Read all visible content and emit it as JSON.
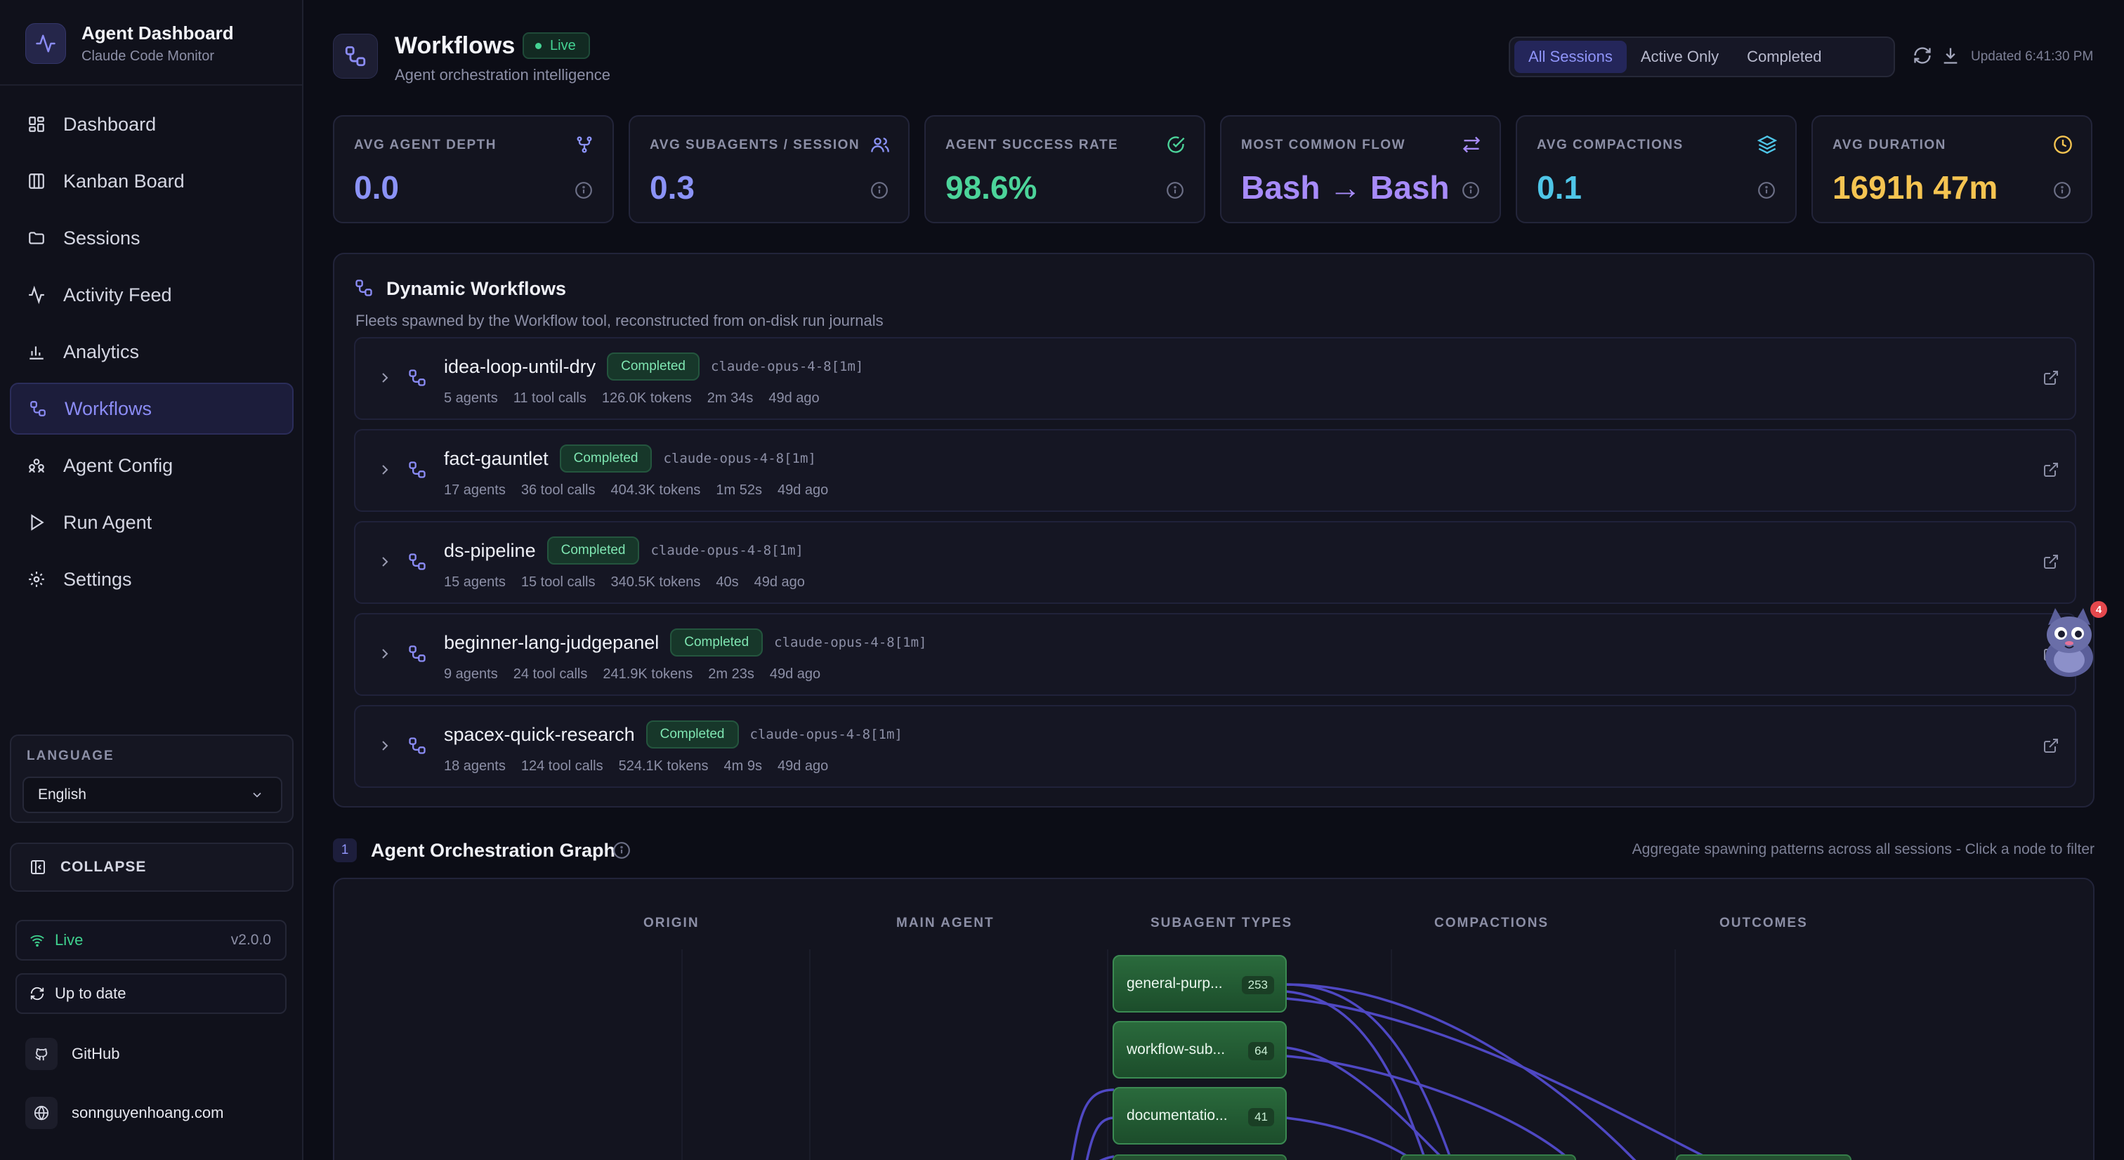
{
  "sidebar": {
    "brand": {
      "title": "Agent Dashboard",
      "subtitle": "Claude Code Monitor"
    },
    "items": [
      {
        "label": "Dashboard",
        "icon": "grid-icon"
      },
      {
        "label": "Kanban Board",
        "icon": "columns-icon"
      },
      {
        "label": "Sessions",
        "icon": "folder-icon"
      },
      {
        "label": "Activity Feed",
        "icon": "activity-icon"
      },
      {
        "label": "Analytics",
        "icon": "bar-chart-icon"
      },
      {
        "label": "Workflows",
        "icon": "workflow-icon",
        "active": true
      },
      {
        "label": "Agent Config",
        "icon": "users-icon"
      },
      {
        "label": "Run Agent",
        "icon": "play-icon"
      },
      {
        "label": "Settings",
        "icon": "gear-icon"
      }
    ],
    "language": {
      "label": "LANGUAGE",
      "value": "English"
    },
    "collapse_label": "COLLAPSE",
    "status": {
      "live": "Live",
      "version": "v2.0.0"
    },
    "update": "Up to date",
    "links": {
      "github": "GitHub",
      "website": "sonnguyenhoang.com"
    }
  },
  "header": {
    "title": "Workflows",
    "badge": "Live",
    "subtitle": "Agent orchestration intelligence",
    "filters": [
      "All Sessions",
      "Active Only",
      "Completed"
    ],
    "active_filter": "All Sessions",
    "updated": "Updated 6:41:30 PM"
  },
  "stats": [
    {
      "label": "AVG AGENT DEPTH",
      "value": "0.0",
      "color": "#8b93f7",
      "icon": "git-fork-icon"
    },
    {
      "label": "AVG SUBAGENTS / SESSION",
      "value": "0.3",
      "color": "#8b93f7",
      "icon": "users-icon"
    },
    {
      "label": "AGENT SUCCESS RATE",
      "value": "98.6%",
      "color": "#4cd49a",
      "icon": "check-circle-icon"
    },
    {
      "label": "MOST COMMON FLOW",
      "value": "Bash → Bash",
      "color": "#a78bfa",
      "icon": "arrows-swap-icon"
    },
    {
      "label": "AVG COMPACTIONS",
      "value": "0.1",
      "color": "#4fc6e8",
      "icon": "layers-icon"
    },
    {
      "label": "AVG DURATION",
      "value": "1691h 47m",
      "color": "#f5c451",
      "icon": "clock-icon"
    }
  ],
  "dynamic_workflows": {
    "title": "Dynamic Workflows",
    "subtitle": "Fleets spawned by the Workflow tool, reconstructed from on-disk run journals",
    "rows": [
      {
        "name": "idea-loop-until-dry",
        "status": "Completed",
        "model": "claude-opus-4-8[1m]",
        "agents": "5 agents",
        "tool_calls": "11 tool calls",
        "tokens": "126.0K tokens",
        "duration": "2m 34s",
        "ago": "49d ago"
      },
      {
        "name": "fact-gauntlet",
        "status": "Completed",
        "model": "claude-opus-4-8[1m]",
        "agents": "17 agents",
        "tool_calls": "36 tool calls",
        "tokens": "404.3K tokens",
        "duration": "1m 52s",
        "ago": "49d ago"
      },
      {
        "name": "ds-pipeline",
        "status": "Completed",
        "model": "claude-opus-4-8[1m]",
        "agents": "15 agents",
        "tool_calls": "15 tool calls",
        "tokens": "340.5K tokens",
        "duration": "40s",
        "ago": "49d ago"
      },
      {
        "name": "beginner-lang-judgepanel",
        "status": "Completed",
        "model": "claude-opus-4-8[1m]",
        "agents": "9 agents",
        "tool_calls": "24 tool calls",
        "tokens": "241.9K tokens",
        "duration": "2m 23s",
        "ago": "49d ago"
      },
      {
        "name": "spacex-quick-research",
        "status": "Completed",
        "model": "claude-opus-4-8[1m]",
        "agents": "18 agents",
        "tool_calls": "124 tool calls",
        "tokens": "524.1K tokens",
        "duration": "4m 9s",
        "ago": "49d ago"
      }
    ]
  },
  "mascot": {
    "notification_count": "4"
  },
  "orchestration": {
    "number": "1",
    "title": "Agent Orchestration Graph",
    "hint": "Aggregate spawning patterns across all sessions - Click a node to filter",
    "columns": [
      "ORIGIN",
      "MAIN AGENT",
      "SUBAGENT TYPES",
      "COMPACTIONS",
      "OUTCOMES"
    ],
    "nodes": [
      {
        "label": "general-purp...",
        "count": "253"
      },
      {
        "label": "workflow-sub...",
        "count": "64"
      },
      {
        "label": "documentatio...",
        "count": "41"
      }
    ]
  },
  "colors": {
    "accent": "#8b8cf5",
    "success": "#4cd49a",
    "warning": "#f5c451",
    "background": "#0c0d16"
  }
}
